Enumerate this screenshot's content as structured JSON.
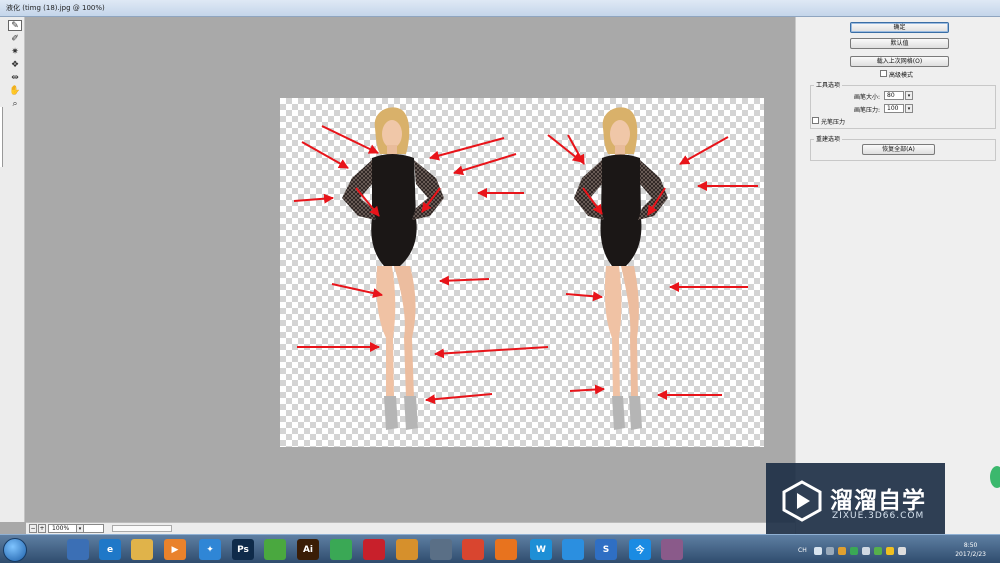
{
  "window": {
    "title": "液化 (timg (18).jpg @ 100%)"
  },
  "tools": [
    {
      "name": "forward-warp-tool-icon",
      "glyph": "✎"
    },
    {
      "name": "reconstruct-tool-icon",
      "glyph": "✐"
    },
    {
      "name": "pucker-tool-icon",
      "glyph": "✷"
    },
    {
      "name": "bloat-tool-icon",
      "glyph": "❖"
    },
    {
      "name": "push-left-tool-icon",
      "glyph": "⇹"
    },
    {
      "name": "hand-tool-icon",
      "glyph": "✋"
    },
    {
      "name": "zoom-tool-icon",
      "glyph": "🔍"
    }
  ],
  "bottom": {
    "zoom": "100%",
    "zoom_out": "−",
    "zoom_in": "+"
  },
  "panel": {
    "ok_label": "确定",
    "reset_label": "默认值",
    "load_last_mesh_label": "载入上次网格(O)",
    "advanced_mode_label": "高级模式",
    "tool_options_label": "工具选项",
    "brush_size_label": "画笔大小:",
    "brush_size_value": "80",
    "brush_pressure_label": "画笔压力:",
    "brush_pressure_value": "100",
    "stylus_pressure_label": "光笔压力",
    "reconstruct_options_label": "重建选项",
    "restore_all_label": "恢复全部(A)"
  },
  "watermark": {
    "cn": "溜溜自学",
    "en": "ZIXUE.3D66.COM"
  },
  "taskbar": {
    "apps": [
      {
        "name": "explorer-icon",
        "text": "",
        "color": "#3b6fb5"
      },
      {
        "name": "ie-icon",
        "text": "e",
        "color": "#1f78c8"
      },
      {
        "name": "folder-icon",
        "text": "",
        "color": "#e0b34a"
      },
      {
        "name": "media-player-icon",
        "text": "▶",
        "color": "#e9822c"
      },
      {
        "name": "app-bird-icon",
        "text": "✦",
        "color": "#2f86d6"
      },
      {
        "name": "photoshop-icon",
        "text": "Ps",
        "color": "#0f2b4a"
      },
      {
        "name": "browser-360-icon",
        "text": "",
        "color": "#4aa83f"
      },
      {
        "name": "illustrator-icon",
        "text": "Ai",
        "color": "#3a1d06"
      },
      {
        "name": "green-app-icon",
        "text": "",
        "color": "#3aa855"
      },
      {
        "name": "acrobat-icon",
        "text": "",
        "color": "#c8202b"
      },
      {
        "name": "box-app-icon",
        "text": "",
        "color": "#d6902c"
      },
      {
        "name": "qq-icon",
        "text": "",
        "color": "#5a6f86"
      },
      {
        "name": "chrome-icon",
        "text": "",
        "color": "#d9452f"
      },
      {
        "name": "firefox-icon",
        "text": "",
        "color": "#e8731e"
      },
      {
        "name": "wps-icon",
        "text": "W",
        "color": "#1e8fd6"
      },
      {
        "name": "blue-app-icon",
        "text": "",
        "color": "#2b8fe0"
      },
      {
        "name": "sogou-icon",
        "text": "S",
        "color": "#2f6fc4"
      },
      {
        "name": "today-app-icon",
        "text": "今",
        "color": "#1a8be3"
      },
      {
        "name": "gift-app-icon",
        "text": "",
        "color": "#8a5a8a"
      }
    ],
    "input_lang": "CH",
    "time": "8:50",
    "date": "2017/2/23"
  },
  "colors": {
    "arrow": "#e8141a",
    "canvas_bg": "#a9a9a9",
    "panel_bg": "#efefef"
  }
}
